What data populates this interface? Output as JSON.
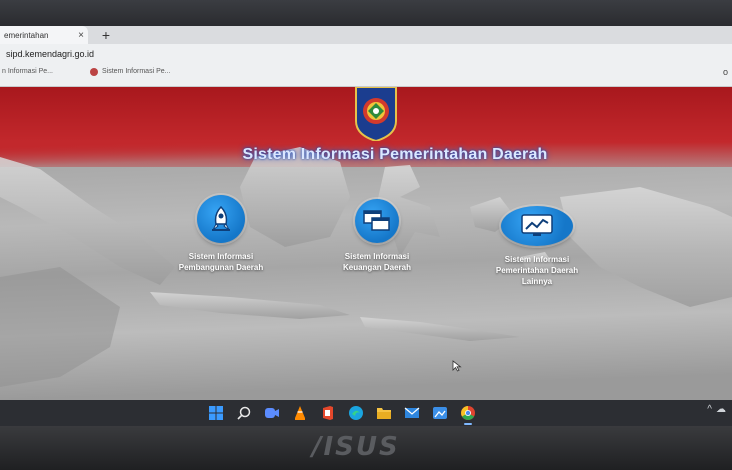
{
  "browser": {
    "tab_title": "emerintahan",
    "tab_close": "×",
    "new_tab": "+",
    "address": "sipd.kemendagri.go.id",
    "bookmarks": [
      "n Informasi Pe...",
      "Sistem Informasi Pe..."
    ],
    "overflow": "o"
  },
  "page": {
    "title": "Sistem Informasi Pemerintahan Daerah",
    "services": [
      {
        "label_line1": "Sistem Informasi",
        "label_line2": "Pembangunan Daerah",
        "label_line3": "",
        "icon": "rocket-icon"
      },
      {
        "label_line1": "Sistem Informasi",
        "label_line2": "Keuangan Daerah",
        "label_line3": "",
        "icon": "windows-icon"
      },
      {
        "label_line1": "Sistem Informasi",
        "label_line2": "Pemerintahan Daerah",
        "label_line3": "Lainnya",
        "icon": "chart-monitor-icon"
      }
    ],
    "colors": {
      "header_red": "#c1262a",
      "service_blue": "#1a86db",
      "title_text": "#dbe7ff"
    }
  },
  "taskbar": {
    "icons": [
      "start-icon",
      "search-icon",
      "meet-icon",
      "vlc-icon",
      "office-icon",
      "edge-icon",
      "file-explorer-icon",
      "mail-icon",
      "photos-icon",
      "chrome-icon"
    ],
    "tray": [
      "^",
      "☁"
    ]
  },
  "bezel": {
    "brand": "/ISUS"
  }
}
